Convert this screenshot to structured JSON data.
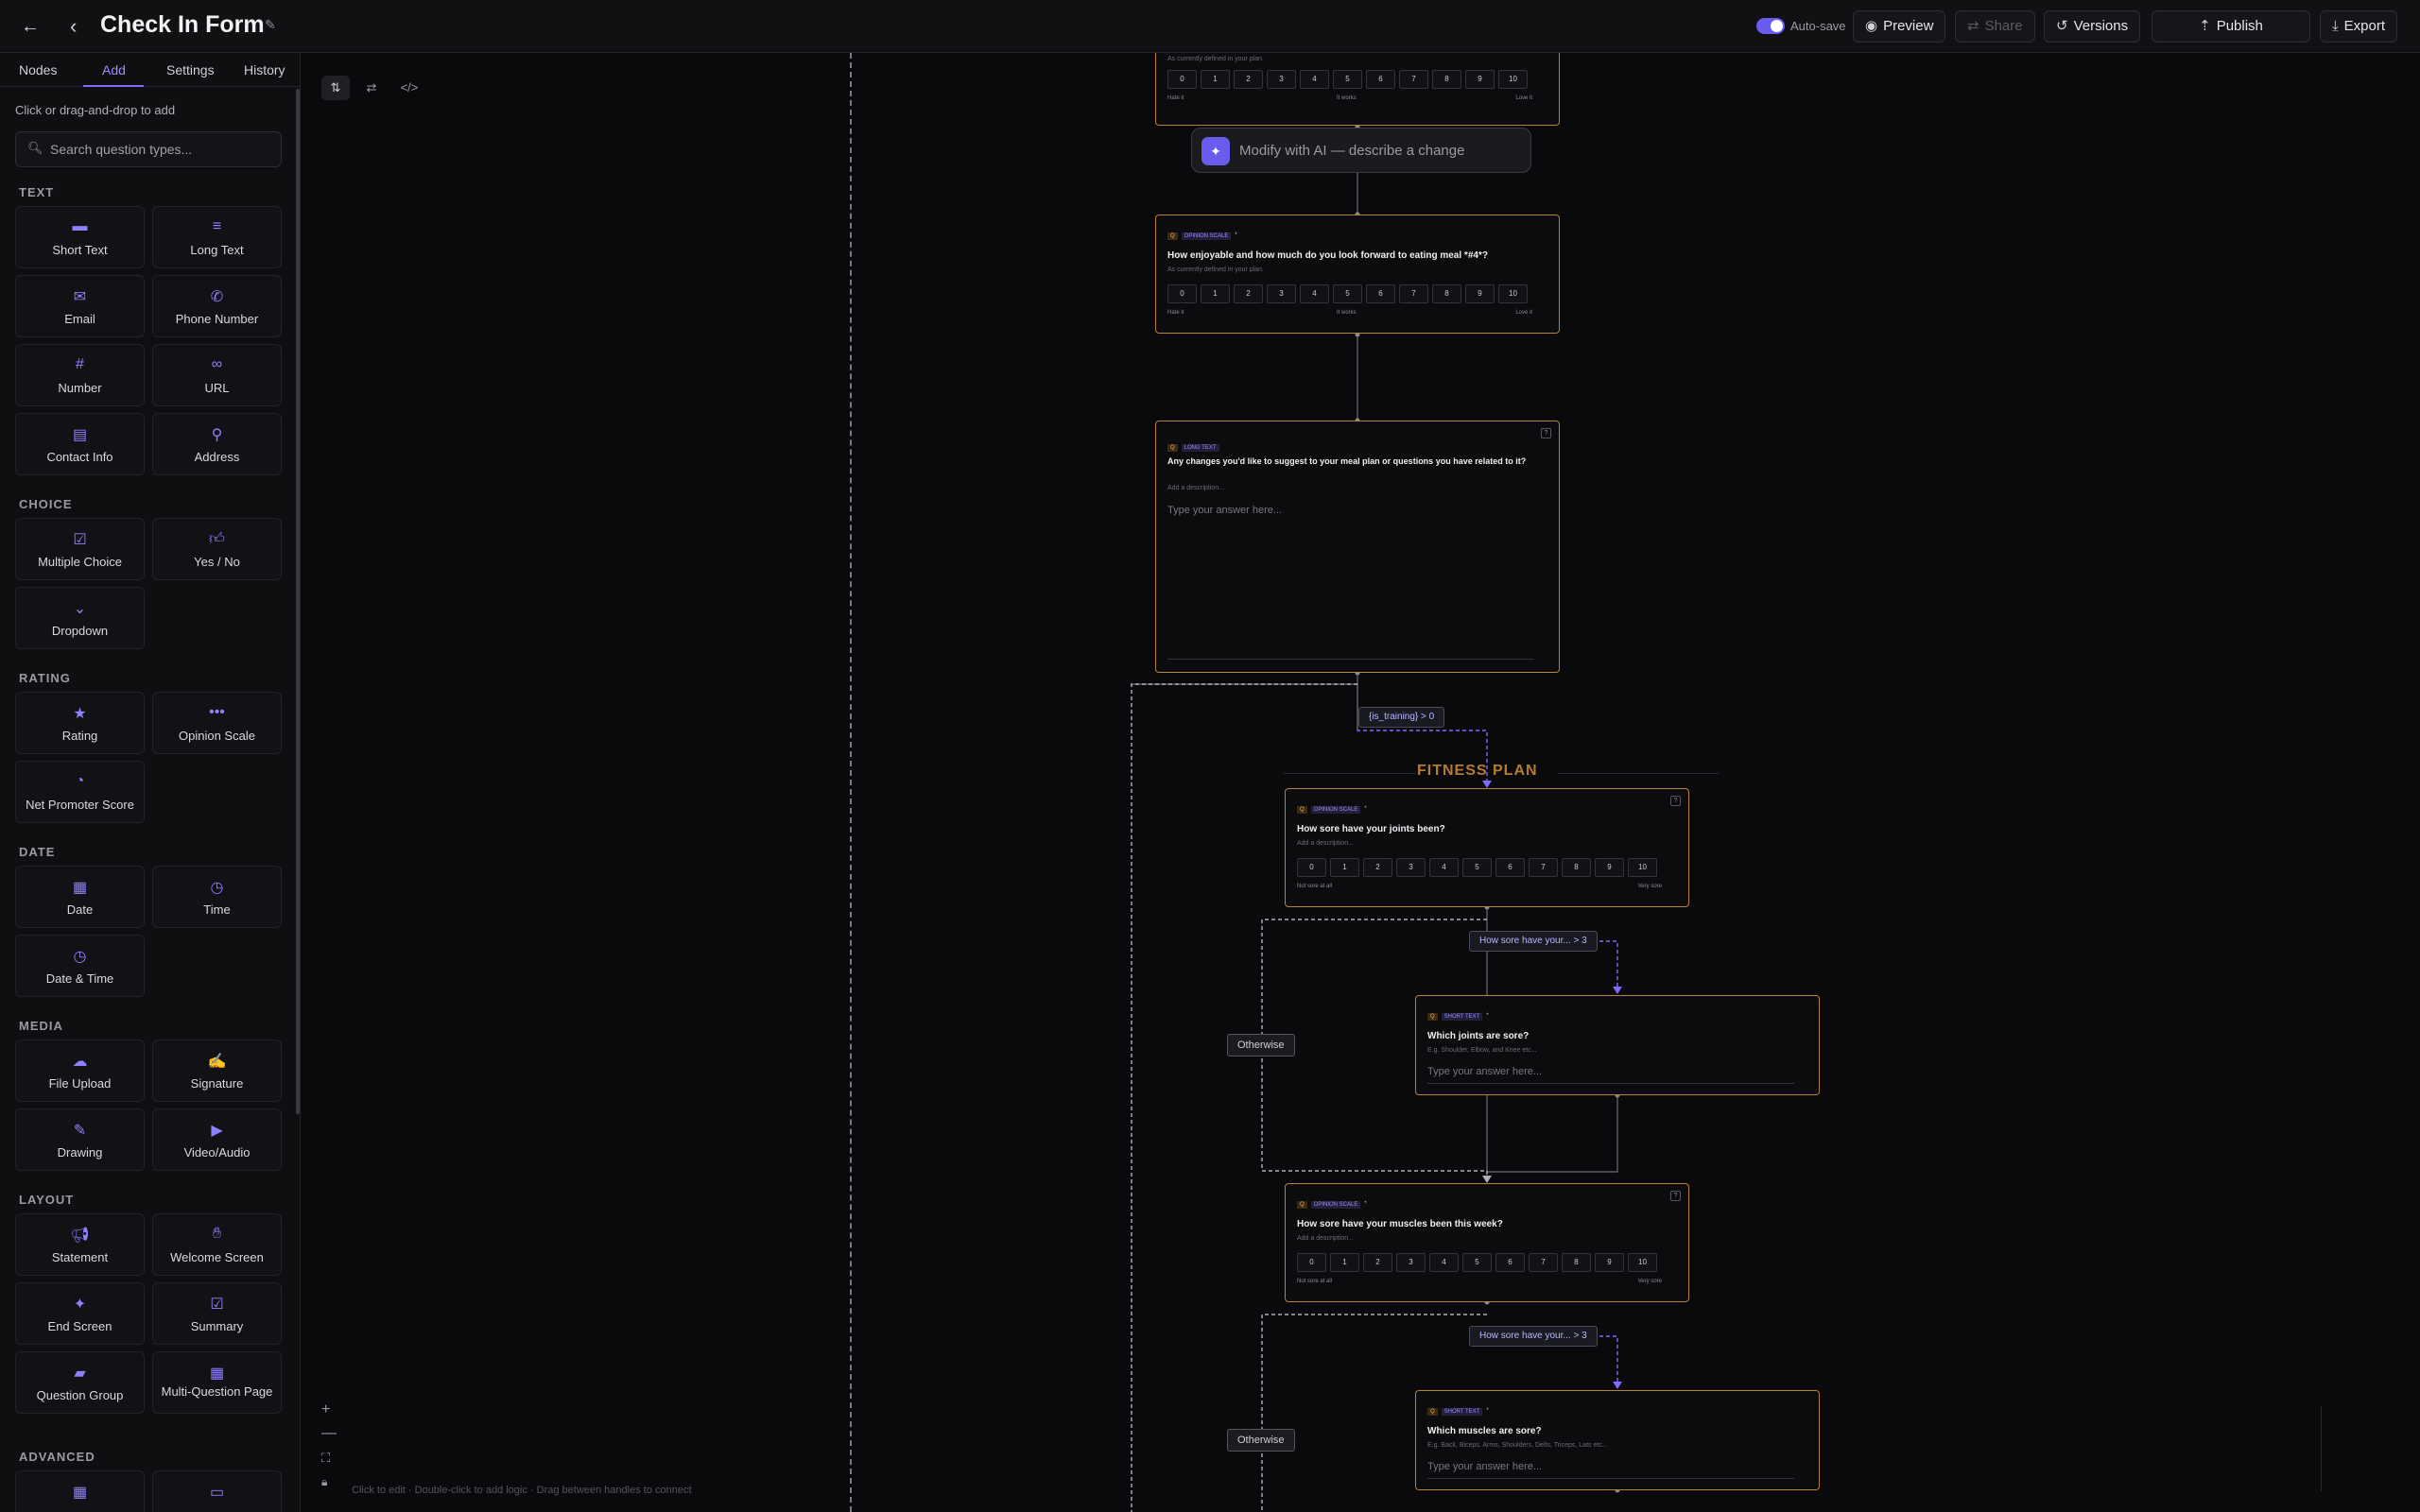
{
  "header": {
    "title": "Check In Form",
    "autosave_label": "Auto-save",
    "buttons": {
      "preview": "Preview",
      "share": "Share",
      "versions": "Versions",
      "publish": "Publish",
      "export": "Export"
    }
  },
  "sidebar": {
    "tabs": [
      "Nodes",
      "Add",
      "Settings",
      "History"
    ],
    "active_tab": "Add",
    "hint": "Click or drag-and-drop to add",
    "search_placeholder": "Search question types...",
    "sections": {
      "text": "TEXT",
      "choice": "CHOICE",
      "rating": "RATING",
      "date": "DATE",
      "media": "MEDIA",
      "layout": "LAYOUT",
      "advanced": "ADVANCED"
    },
    "items": {
      "short_text": "Short Text",
      "long_text": "Long Text",
      "email": "Email",
      "phone": "Phone Number",
      "number": "Number",
      "url": "URL",
      "contact": "Contact Info",
      "address": "Address",
      "multiple_choice": "Multiple Choice",
      "yes_no": "Yes / No",
      "dropdown": "Dropdown",
      "rating": "Rating",
      "opinion_scale": "Opinion Scale",
      "nps": "Net Promoter Score",
      "date": "Date",
      "time": "Time",
      "date_time": "Date & Time",
      "file_upload": "File Upload",
      "signature": "Signature",
      "drawing": "Drawing",
      "video_audio": "Video/Audio",
      "statement": "Statement",
      "welcome": "Welcome Screen",
      "end_screen": "End Screen",
      "summary": "Summary",
      "question_group": "Question Group",
      "multi_question": "Multi-Question Page"
    }
  },
  "canvas": {
    "ai_prompt": "Modify with AI — describe a change",
    "footer_hint": "Click to edit · Double-click to add logic · Drag between handles to connect",
    "group_title": "FITNESS PLAN",
    "scale_values": [
      "0",
      "1",
      "2",
      "3",
      "4",
      "5",
      "6",
      "7",
      "8",
      "9",
      "10"
    ],
    "top_card": {
      "desc": "As currently defined in your plan.",
      "low": "Hate it",
      "mid": "It works",
      "high": "Love it"
    },
    "card_meal": {
      "num": "Q",
      "type": "OPINION SCALE",
      "question": "How enjoyable and how much do you look forward to eating meal *#4*?",
      "desc": "As currently defined in your plan.",
      "low": "Hate it",
      "mid": "It works",
      "high": "Love it"
    },
    "card_changes": {
      "num": "Q",
      "type": "LONG TEXT",
      "question": "Any changes you'd like to suggest to your meal plan or questions you have related to it?",
      "desc": "Add a description...",
      "placeholder": "Type your answer here..."
    },
    "cond_training": "{is_training} > 0",
    "card_joints": {
      "num": "Q",
      "type": "OPINION SCALE",
      "question": "How sore have your joints been?",
      "desc": "Add a description...",
      "low": "Not sore at all",
      "high": "Very sore"
    },
    "cond_joints": "How sore have your... > 3",
    "otherwise": "Otherwise",
    "card_which_joints": {
      "num": "Q",
      "type": "SHORT TEXT",
      "question": "Which joints are sore?",
      "desc": "E.g. Shoulder, Elbow, and Knee etc...",
      "placeholder": "Type your answer here..."
    },
    "card_muscles": {
      "num": "Q",
      "type": "OPINION SCALE",
      "question": "How sore have your muscles been this week?",
      "desc": "Add a description...",
      "low": "Not sore at all",
      "high": "Very sore"
    },
    "cond_muscles": "How sore have your... > 3",
    "card_which_muscles": {
      "num": "Q",
      "type": "SHORT TEXT",
      "question": "Which muscles are sore?",
      "desc": "E.g. Back, Biceps, Arms, Shoulders, Delts, Triceps, Lats etc...",
      "placeholder": "Type your answer here..."
    }
  }
}
